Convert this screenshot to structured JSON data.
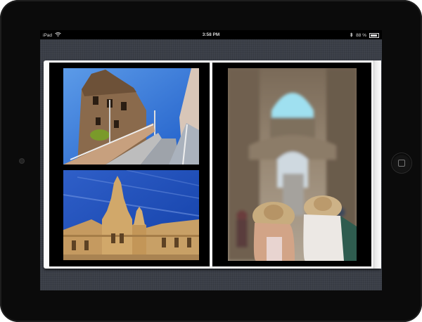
{
  "status_bar": {
    "device": "iPad",
    "time": "3:58 PM",
    "battery": "88 %"
  },
  "icons": {
    "wifi": "wifi-icon",
    "bluetooth": "bluetooth-icon",
    "battery": "battery-icon",
    "home": "home-button-icon"
  },
  "colors": {
    "bezel": "#0b0b0b",
    "linen": "#3b3f48",
    "page": "#fbfbfb",
    "photo_mat": "#000000"
  },
  "album": {
    "left_page_photos": [
      "castle-tower-photo",
      "palace-dome-photo"
    ],
    "right_page_photos": [
      "street-tourists-photo"
    ]
  }
}
